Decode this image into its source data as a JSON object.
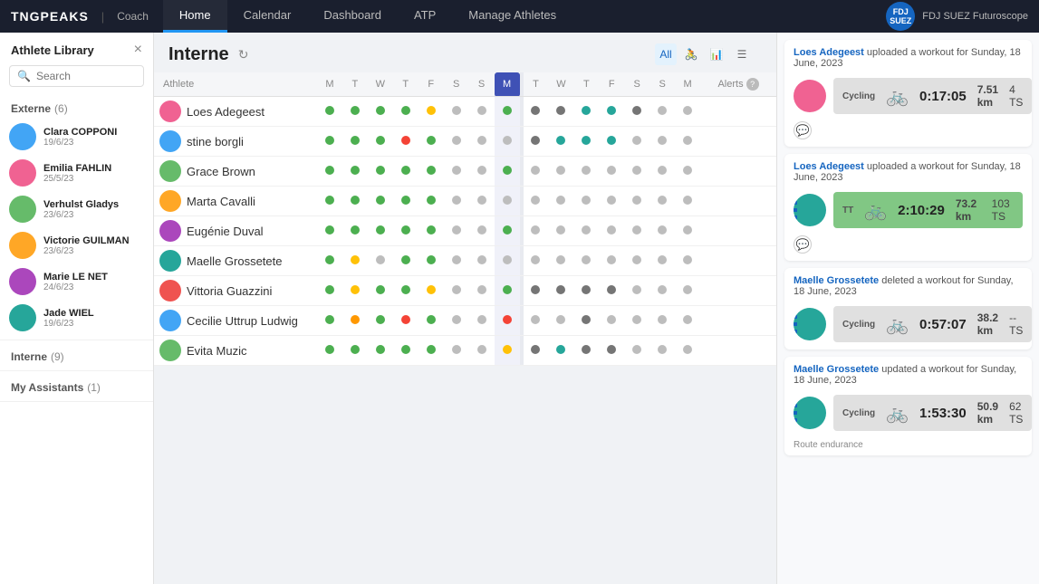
{
  "nav": {
    "logo": "TNGPEAKS",
    "separator": "|",
    "coach": "Coach",
    "tabs": [
      "Home",
      "Calendar",
      "Dashboard",
      "ATP",
      "Manage Athletes"
    ],
    "active_tab": "Home",
    "team_name": "FDJ SUEZ Futuroscope",
    "team_short": "FDJF\nSUEZ"
  },
  "sidebar": {
    "title": "Athlete Library",
    "search_placeholder": "Search",
    "add_btn": "+",
    "close_btn": "×",
    "sections": [
      {
        "label": "Externe",
        "count": 6,
        "athletes": [
          {
            "name": "Clara COPPONI",
            "date": "19/6/23",
            "color": "av-blue"
          },
          {
            "name": "Emilia FAHLIN",
            "date": "25/5/23",
            "color": "av-pink"
          },
          {
            "name": "Verhulst Gladys",
            "date": "23/6/23",
            "color": "av-green"
          },
          {
            "name": "Victorie GUILMAN",
            "date": "23/6/23",
            "color": "av-orange"
          },
          {
            "name": "Marie LE NET",
            "date": "24/6/23",
            "color": "av-purple"
          },
          {
            "name": "Jade WIEL",
            "date": "19/6/23",
            "color": "av-teal"
          }
        ]
      },
      {
        "label": "Interne",
        "count": 9,
        "athletes": []
      },
      {
        "label": "My Assistants",
        "count": 1,
        "athletes": []
      }
    ]
  },
  "page": {
    "title": "Interne",
    "refresh": "↻"
  },
  "table": {
    "cols_left": [
      "M",
      "T",
      "W",
      "T",
      "F",
      "S",
      "S",
      "M"
    ],
    "col_highlight_index": 7,
    "cols_right": [
      "T",
      "W",
      "T",
      "F",
      "S",
      "S",
      "M"
    ],
    "alerts_label": "Alerts",
    "view_all": "All",
    "athletes": [
      {
        "name": "Loes Adegeest",
        "color": "av-pink",
        "dots_left": [
          "green",
          "green",
          "green",
          "green",
          "yellow",
          "gray",
          "gray",
          "green"
        ],
        "dots_right": [
          "dark-gray",
          "dark-gray",
          "teal",
          "teal",
          "dark-gray",
          "gray",
          "gray"
        ],
        "alert": ""
      },
      {
        "name": "stine borgli",
        "color": "av-blue",
        "dots_left": [
          "green",
          "green",
          "green",
          "red",
          "green",
          "gray",
          "gray",
          "gray"
        ],
        "dots_right": [
          "dark-gray",
          "teal",
          "teal",
          "teal",
          "gray",
          "gray",
          "gray"
        ],
        "alert": ""
      },
      {
        "name": "Grace Brown",
        "color": "av-green",
        "dots_left": [
          "green",
          "green",
          "green",
          "green",
          "green",
          "gray",
          "gray",
          "green"
        ],
        "dots_right": [
          "gray",
          "gray",
          "gray",
          "gray",
          "gray",
          "gray",
          "gray"
        ],
        "alert": ""
      },
      {
        "name": "Marta Cavalli",
        "color": "av-orange",
        "dots_left": [
          "green",
          "green",
          "green",
          "green",
          "green",
          "gray",
          "gray",
          "gray"
        ],
        "dots_right": [
          "gray",
          "gray",
          "gray",
          "gray",
          "gray",
          "gray",
          "gray"
        ],
        "alert": ""
      },
      {
        "name": "Eugénie Duval",
        "color": "av-purple",
        "dots_left": [
          "green",
          "green",
          "green",
          "green",
          "green",
          "gray",
          "gray",
          "green"
        ],
        "dots_right": [
          "gray",
          "gray",
          "gray",
          "gray",
          "gray",
          "gray",
          "gray"
        ],
        "alert": ""
      },
      {
        "name": "Maelle Grossetete",
        "color": "av-teal",
        "dots_left": [
          "green",
          "yellow",
          "gray",
          "green",
          "green",
          "gray",
          "gray",
          "gray"
        ],
        "dots_right": [
          "gray",
          "gray",
          "gray",
          "gray",
          "gray",
          "gray",
          "gray"
        ],
        "alert": ""
      },
      {
        "name": "Vittoria Guazzini",
        "color": "av-red",
        "dots_left": [
          "green",
          "yellow",
          "green",
          "green",
          "yellow",
          "gray",
          "gray",
          "green"
        ],
        "dots_right": [
          "dark-gray",
          "dark-gray",
          "dark-gray",
          "dark-gray",
          "gray",
          "gray",
          "gray"
        ],
        "alert": ""
      },
      {
        "name": "Cecilie Uttrup Ludwig",
        "color": "av-blue",
        "dots_left": [
          "green",
          "orange",
          "green",
          "red",
          "green",
          "gray",
          "gray",
          "red"
        ],
        "dots_right": [
          "gray",
          "gray",
          "dark-gray",
          "gray",
          "gray",
          "gray",
          "gray"
        ],
        "alert": ""
      },
      {
        "name": "Evita Muzic",
        "color": "av-green",
        "dots_left": [
          "green",
          "green",
          "green",
          "green",
          "green",
          "gray",
          "gray",
          "yellow"
        ],
        "dots_right": [
          "dark-gray",
          "teal",
          "dark-gray",
          "dark-gray",
          "gray",
          "gray",
          "gray"
        ],
        "alert": ""
      }
    ]
  },
  "activity_feed": [
    {
      "athlete": "Loes Adegeest",
      "action": "uploaded a workout for Sunday, 18 June, 2023",
      "type": "Cycling",
      "bg": "cycling",
      "duration": "0:17:05",
      "distance": "7.51 km",
      "tss": "4 TS",
      "has_comment": true,
      "has_stripe": false
    },
    {
      "athlete": "Loes Adegeest",
      "action": "uploaded a workout for Sunday, 18 June, 2023",
      "type": "TT",
      "bg": "tt",
      "duration": "2:10:29",
      "distance": "73.2 km",
      "tss": "103 TS",
      "has_comment": true,
      "has_stripe": true
    },
    {
      "athlete": "Maelle Grossetete",
      "action": "deleted a workout for Sunday, 18 June, 2023",
      "type": "Cycling",
      "bg": "cycling",
      "duration": "0:57:07",
      "distance": "38.2 km",
      "tss": "-- TS",
      "has_comment": false,
      "has_stripe": true
    },
    {
      "athlete": "Maelle Grossetete",
      "action": "updated a workout for Sunday, 18 June, 2023",
      "type": "Cycling",
      "bg": "cycling",
      "duration": "1:53:30",
      "distance": "50.9 km",
      "tss": "62 TS",
      "has_comment": false,
      "has_stripe": true,
      "note": "Route endurance"
    }
  ]
}
